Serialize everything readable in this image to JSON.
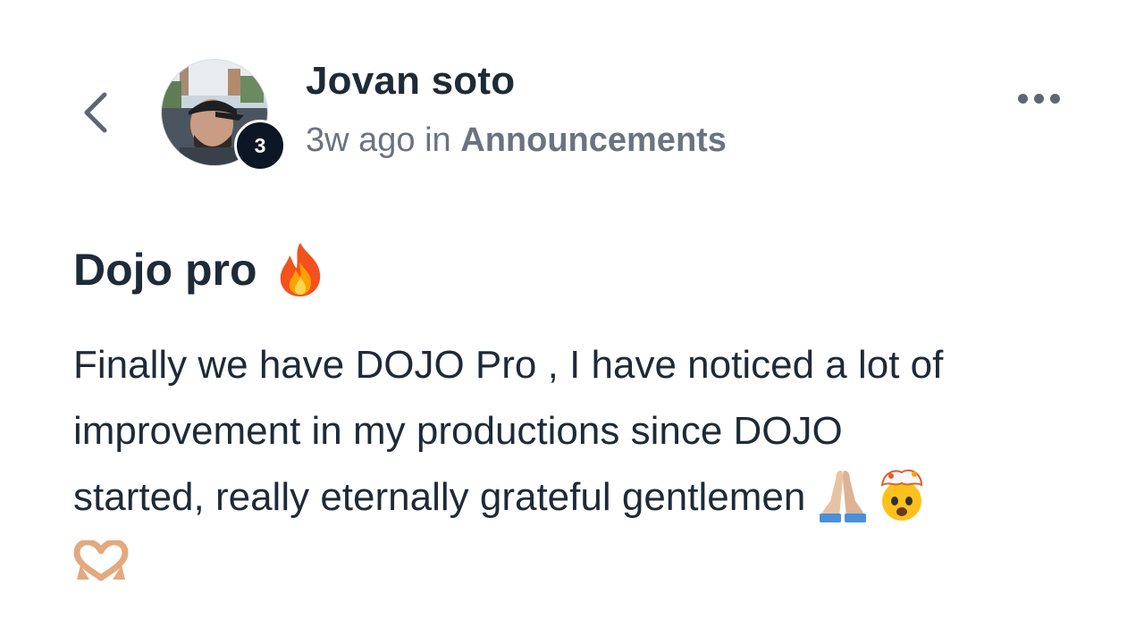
{
  "header": {
    "back_icon": "chevron-left-icon",
    "author": {
      "name": "Jovan soto",
      "level": "3"
    },
    "meta": {
      "time": "3w ago",
      "connector": "in",
      "category": "Announcements"
    },
    "more_icon": "more-horizontal-icon"
  },
  "post": {
    "title": "Dojo pro",
    "title_emoji": "fire-emoji",
    "body_lines": [
      "Finally we have DOJO Pro , I have noticed a lot of",
      "improvement in my productions since DOJO",
      "started, really eternally grateful gentlemen"
    ],
    "body_emojis": [
      "folded-hands-emoji",
      "exploding-head-emoji",
      "heart-hands-emoji"
    ]
  },
  "colors": {
    "text_primary": "#1f2a37",
    "text_secondary": "#6b7280",
    "badge_bg": "#0c1624",
    "icon_gray": "#5f6673"
  }
}
